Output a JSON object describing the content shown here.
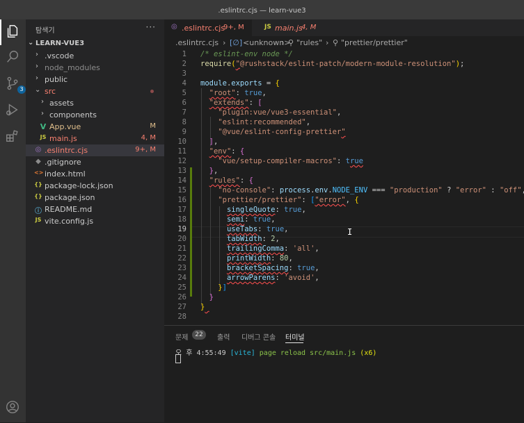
{
  "window": {
    "title": ".eslintrc.cjs — learn-vue3"
  },
  "activity_bar": {
    "scm_badge": "3"
  },
  "sidebar": {
    "title": "탐색기",
    "more": "···",
    "section": "LEARN-VUE3",
    "items": [
      {
        "name": ".vscode",
        "kind": "folder",
        "expanded": false,
        "status": ""
      },
      {
        "name": "node_modules",
        "kind": "folder",
        "expanded": false,
        "status": ""
      },
      {
        "name": "public",
        "kind": "folder",
        "expanded": false,
        "status": ""
      },
      {
        "name": "src",
        "kind": "folder",
        "expanded": true,
        "status": ""
      },
      {
        "name": "assets",
        "kind": "folder",
        "expanded": false,
        "status": ""
      },
      {
        "name": "components",
        "kind": "folder",
        "expanded": false,
        "status": ""
      },
      {
        "name": "App.vue",
        "kind": "vue",
        "status": "M"
      },
      {
        "name": "main.js",
        "kind": "js",
        "status": "4, M"
      },
      {
        "name": ".eslintrc.cjs",
        "kind": "eslint",
        "status": "9+, M"
      },
      {
        "name": ".gitignore",
        "kind": "git",
        "status": ""
      },
      {
        "name": "index.html",
        "kind": "html",
        "status": ""
      },
      {
        "name": "package-lock.json",
        "kind": "json",
        "status": ""
      },
      {
        "name": "package.json",
        "kind": "json",
        "status": ""
      },
      {
        "name": "README.md",
        "kind": "md",
        "status": ""
      },
      {
        "name": "vite.config.js",
        "kind": "js",
        "status": ""
      }
    ]
  },
  "tabs": [
    {
      "name": ".eslintrc.cjs",
      "status": "9+, M",
      "icon": "eslint-icon"
    },
    {
      "name": "main.js",
      "status": "4, M",
      "icon": "JS"
    }
  ],
  "breadcrumb": {
    "file": ".eslintrc.cjs",
    "p1": "<unknown>",
    "p2": "\"rules\"",
    "p3": "\"prettier/prettier\""
  },
  "editor": {
    "line_numbers": [
      "1",
      "2",
      "3",
      "4",
      "5",
      "6",
      "7",
      "8",
      "9",
      "10",
      "11",
      "12",
      "13",
      "14",
      "15",
      "16",
      "17",
      "18",
      "19",
      "20",
      "21",
      "22",
      "23",
      "24",
      "25",
      "26",
      "27",
      "28"
    ],
    "current_line": "19"
  },
  "panel": {
    "tabs": [
      "문제",
      "출력",
      "디버그 콘솔",
      "터미널"
    ],
    "problems_count": "22",
    "terminal": {
      "time": "오 후 4:55:49",
      "tag": "[vite]",
      "message": "page reload src/main.js",
      "count": "(x6)"
    }
  },
  "colors": {
    "modified": "#e2c08d",
    "error": "#f88070",
    "vue": "#41b883",
    "js": "#cbcb41",
    "accent": "#0e639c"
  }
}
